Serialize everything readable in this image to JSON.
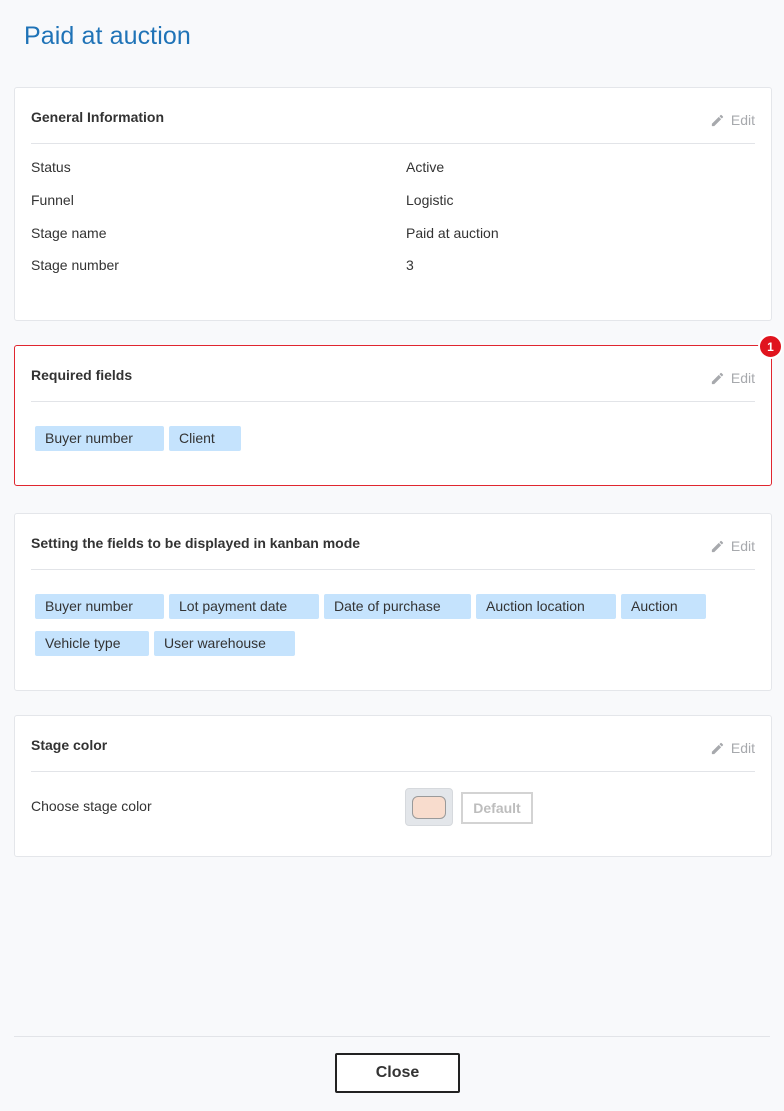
{
  "page": {
    "title": "Paid at auction"
  },
  "edit_label": "Edit",
  "general": {
    "title": "General Information",
    "rows": [
      {
        "label": "Status",
        "value": "Active"
      },
      {
        "label": "Funnel",
        "value": "Logistic"
      },
      {
        "label": "Stage name",
        "value": "Paid at auction"
      },
      {
        "label": "Stage number",
        "value": "3"
      }
    ]
  },
  "required": {
    "title": "Required fields",
    "badge": "1",
    "chips": [
      "Buyer number",
      "Client"
    ]
  },
  "kanban": {
    "title": "Setting the fields to be displayed in kanban mode",
    "chips": [
      "Buyer number",
      "Lot payment date",
      "Date of purchase",
      "Auction location",
      "Auction",
      "Vehicle type",
      "User warehouse"
    ]
  },
  "stage_color": {
    "title": "Stage color",
    "label": "Choose stage color",
    "swatch_color": "#f8dccd",
    "default_label": "Default"
  },
  "footer": {
    "close_label": "Close"
  },
  "colors": {
    "accent": "#1f73b7",
    "chip_bg": "#c5e3fd",
    "highlight_border": "#e0262f",
    "badge_bg": "#e0141e"
  }
}
